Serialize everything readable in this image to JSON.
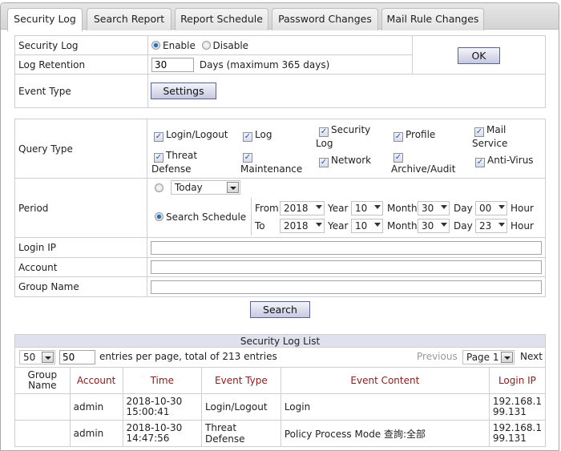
{
  "tabs": [
    {
      "label": "Security Log",
      "active": true
    },
    {
      "label": "Search Report",
      "active": false
    },
    {
      "label": "Report Schedule",
      "active": false
    },
    {
      "label": "Password Changes",
      "active": false
    },
    {
      "label": "Mail Rule Changes",
      "active": false
    }
  ],
  "settings": {
    "security_log_label": "Security Log",
    "enable_label": "Enable",
    "disable_label": "Disable",
    "enabled": true,
    "log_retention_label": "Log Retention",
    "log_retention_value": "30",
    "log_retention_suffix": "Days (maximum 365 days)",
    "event_type_label": "Event Type",
    "settings_button": "Settings",
    "ok_button": "OK"
  },
  "query": {
    "query_type_label": "Query Type",
    "types": [
      {
        "label": "Login/Logout",
        "checked": true
      },
      {
        "label": "Log",
        "checked": true
      },
      {
        "label": "Security Log",
        "checked": true
      },
      {
        "label": "Profile",
        "checked": true
      },
      {
        "label": "Mail Service",
        "checked": true
      },
      {
        "label": "Threat Defense",
        "checked": true
      },
      {
        "label": "Maintenance",
        "checked": true
      },
      {
        "label": "Network",
        "checked": true
      },
      {
        "label": "Archive/Audit",
        "checked": true
      },
      {
        "label": "Anti-Virus",
        "checked": true
      }
    ],
    "period_label": "Period",
    "today_option": "Today",
    "search_schedule_label": "Search Schedule",
    "from_label": "From",
    "to_label": "To",
    "year_label": "Year",
    "month_label": "Month",
    "day_label": "Day",
    "hour_label": "Hour",
    "from": {
      "year": "2018",
      "month": "10",
      "day": "30",
      "hour": "00"
    },
    "to": {
      "year": "2018",
      "month": "10",
      "day": "30",
      "hour": "23"
    },
    "login_ip_label": "Login IP",
    "login_ip_value": "",
    "account_label": "Account",
    "account_value": "",
    "group_name_label": "Group Name",
    "group_name_value": "",
    "search_button": "Search"
  },
  "list": {
    "title": "Security Log List",
    "per_page_select": "50",
    "per_page_input": "50",
    "entries_text": "entries per page, total of 213 entries",
    "previous_label": "Previous",
    "page_select": "Page 1",
    "next_label": "Next",
    "columns": [
      "Group Name",
      "Account",
      "Time",
      "Event Type",
      "Event Content",
      "Login IP"
    ],
    "rows": [
      {
        "group": "",
        "account": "admin",
        "time_date": "2018-10-30",
        "time_clock": "15:00:41",
        "event_type": "Login/Logout",
        "content": "Login",
        "ip_a": "192.168.1",
        "ip_b": "99.131"
      },
      {
        "group": "",
        "account": "admin",
        "time_date": "2018-10-30",
        "time_clock": "14:47:56",
        "event_type": "Threat Defense",
        "content": "Policy Process Mode 查詢:全部",
        "ip_a": "192.168.1",
        "ip_b": "99.131"
      }
    ]
  }
}
